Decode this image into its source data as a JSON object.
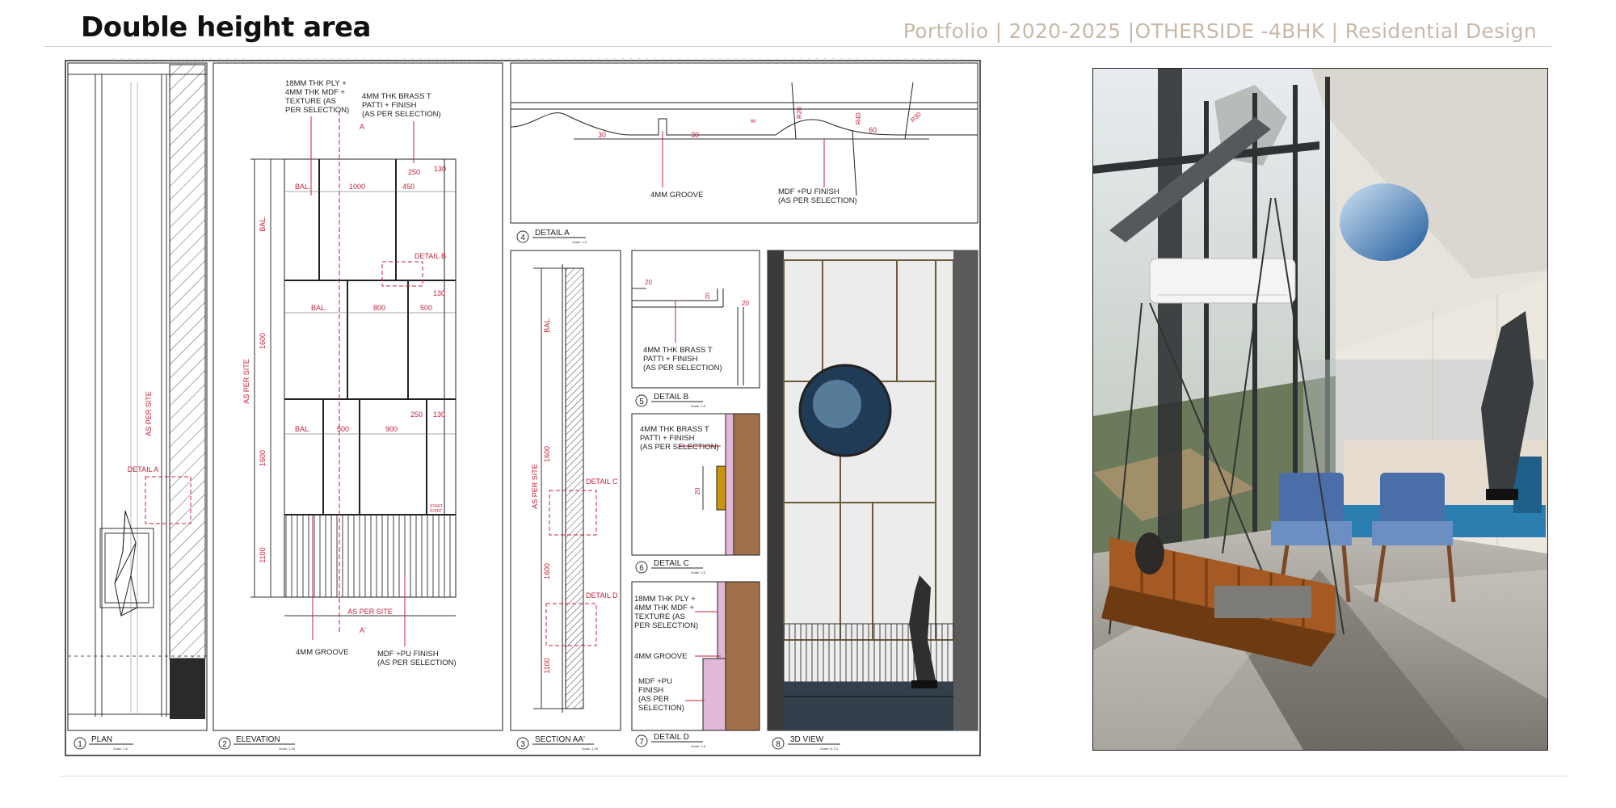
{
  "header": {
    "title": "Double height area",
    "subtitle": "Portfolio | 2020-2025 |OTHERSIDE  -4BHK | Residential Design"
  },
  "drawings": {
    "plan": {
      "num": "1",
      "title": "PLAN",
      "scale": "Scale: 1:8",
      "detail_a": "DETAIL A",
      "as_per_site": "AS PER SITE"
    },
    "elevation": {
      "num": "2",
      "title": "ELEVATION",
      "scale": "Scale: 1:25",
      "note_ply": [
        "18MM THK PLY +",
        "4MM THK MDF +",
        "TEXTURE (AS",
        "PER SELECTION)"
      ],
      "note_brass": [
        "4MM THK BRASS T",
        "PATTI + FINISH",
        "(AS PER SELECTION)"
      ],
      "section_a": "A",
      "section_a2": "A'",
      "dims_top": [
        "BAL.",
        "1000",
        "450",
        "250",
        "130"
      ],
      "dims_mid": [
        "BAL.",
        "800",
        "500",
        "130"
      ],
      "dims_low": [
        "BAL.",
        "500",
        "900",
        "250",
        "130"
      ],
      "heights": [
        "BAL.",
        "1600",
        "1600",
        "1100"
      ],
      "as_per_site": "AS PER SITE",
      "detail_b": "DETAIL B",
      "start_point": [
        "START",
        "POINT"
      ],
      "groove": "4MM GROOVE",
      "mdf_note": [
        "MDF +PU FINISH",
        "(AS PER SELECTION)"
      ]
    },
    "section": {
      "num": "3",
      "title": "SECTION AA'",
      "scale": "Scale: 1:25",
      "heights": [
        "BAL.",
        "1600",
        "1600",
        "1100"
      ],
      "as_per_site": "AS PER SITE",
      "detail_c": "DETAIL C",
      "detail_d": "DETAIL D"
    },
    "detail_a": {
      "num": "4",
      "title": "DETAIL A",
      "scale": "Scale: 1:5",
      "dims": [
        "30",
        "30",
        "8",
        "R20",
        "R40",
        "60",
        "R30"
      ],
      "groove": "4MM GROOVE",
      "mdf_note": [
        "MDF +PU FINISH",
        "(AS PER SELECTION)"
      ]
    },
    "detail_b": {
      "num": "5",
      "title": "DETAIL B",
      "scale": "Scale: 1:5",
      "dims": [
        "20",
        "20",
        "20"
      ],
      "note": [
        "4MM THK BRASS T",
        "PATTI + FINISH",
        "(AS PER SELECTION)"
      ]
    },
    "detail_c": {
      "num": "6",
      "title": "DETAIL C",
      "scale": "Scale: 1:5",
      "dim": "20",
      "note": [
        "4MM THK BRASS T",
        "PATTI + FINISH",
        "(AS PER SELECTION)"
      ]
    },
    "detail_d": {
      "num": "7",
      "title": "DETAIL D",
      "scale": "Scale: 1:5",
      "note_ply": [
        "18MM THK PLY +",
        "4MM THK MDF +",
        "TEXTURE (AS",
        "PER SELECTION)"
      ],
      "groove": "4MM GROOVE",
      "mdf_note": [
        "MDF +PU",
        "FINISH",
        "(AS PER",
        "SELECTION)"
      ]
    },
    "view3d": {
      "num": "8",
      "title": "3D VIEW",
      "scale": "Scale: N.T.S."
    }
  },
  "colors": {
    "dimension_red": "#c8203a",
    "subtitle": "#c9b8a8",
    "wood": "#a0704a",
    "pink": "#e0b8d8",
    "brass": "#c8960a"
  }
}
